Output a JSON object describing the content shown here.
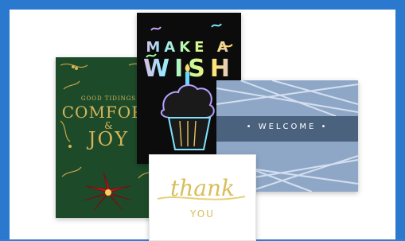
{
  "cards": {
    "holiday": {
      "line1": "GOOD TIDINGS",
      "line2": "COMFORT",
      "amp": "&",
      "line3": "JOY"
    },
    "birthday": {
      "line1": "MAKE A",
      "line2": "WISH"
    },
    "welcome": {
      "label": "•   WELCOME   •"
    },
    "thankyou": {
      "line1": "thank",
      "line2": "YOU"
    }
  },
  "colors": {
    "border_blue": "#2a79cf",
    "green_card": "#1d4b2a",
    "black_card": "#0c0c0c",
    "blue_card": "#8fa7c7",
    "gold": "#d8be59"
  }
}
